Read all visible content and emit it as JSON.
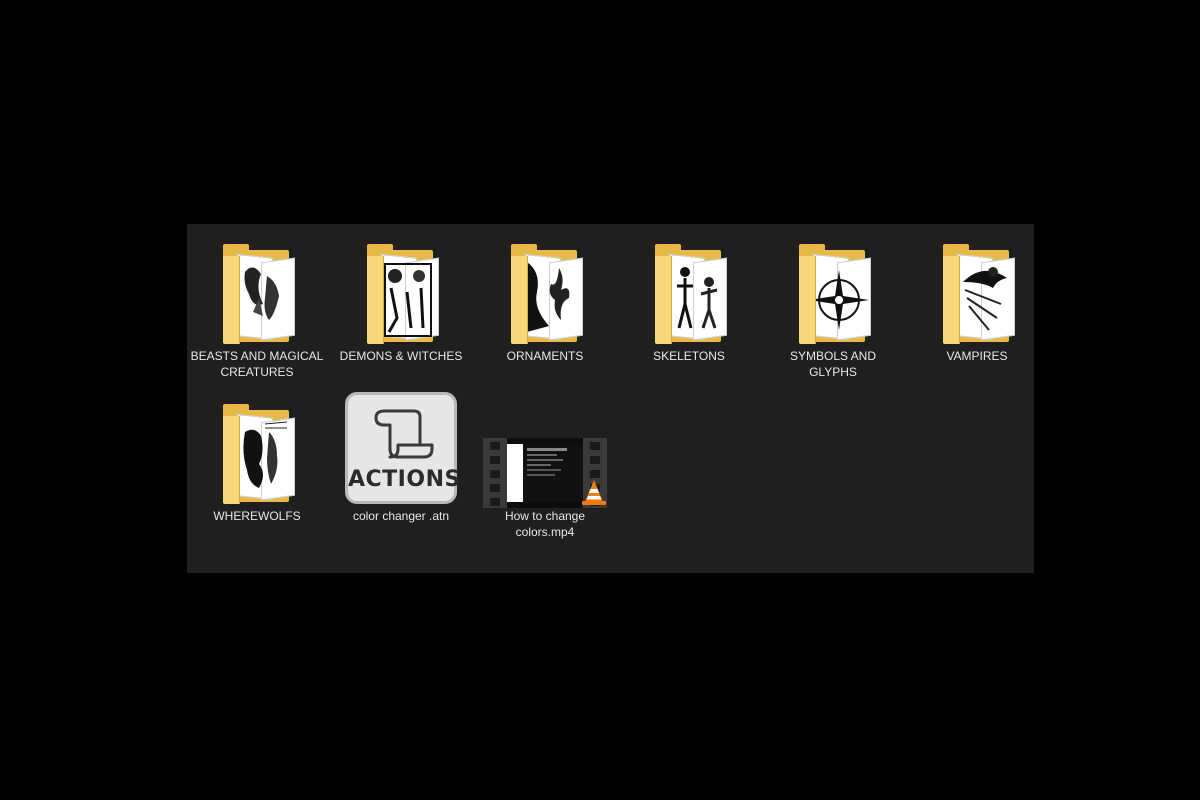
{
  "colors": {
    "background": "#000000",
    "pane": "#1f1f1f",
    "folder": "#e8b94a",
    "folder_front": "#f6d77a",
    "label": "#e8e8e8"
  },
  "items": [
    {
      "label": "BEASTS AND MAGICAL CREATURES",
      "icon": "folder-icon"
    },
    {
      "label": "DEMONS & WITCHES",
      "icon": "folder-icon"
    },
    {
      "label": "ORNAMENTS",
      "icon": "folder-icon"
    },
    {
      "label": "SKELETONS",
      "icon": "folder-icon"
    },
    {
      "label": "SYMBOLS AND GLYPHS",
      "icon": "folder-icon"
    },
    {
      "label": "VAMPIRES",
      "icon": "folder-icon"
    },
    {
      "label": "WHEREWOLFS",
      "icon": "folder-icon"
    },
    {
      "label": "color changer .atn",
      "icon": "actions-file-icon",
      "badge": "ACTIONS"
    },
    {
      "label": "How to change colors.mp4",
      "icon": "video-file-icon"
    }
  ]
}
